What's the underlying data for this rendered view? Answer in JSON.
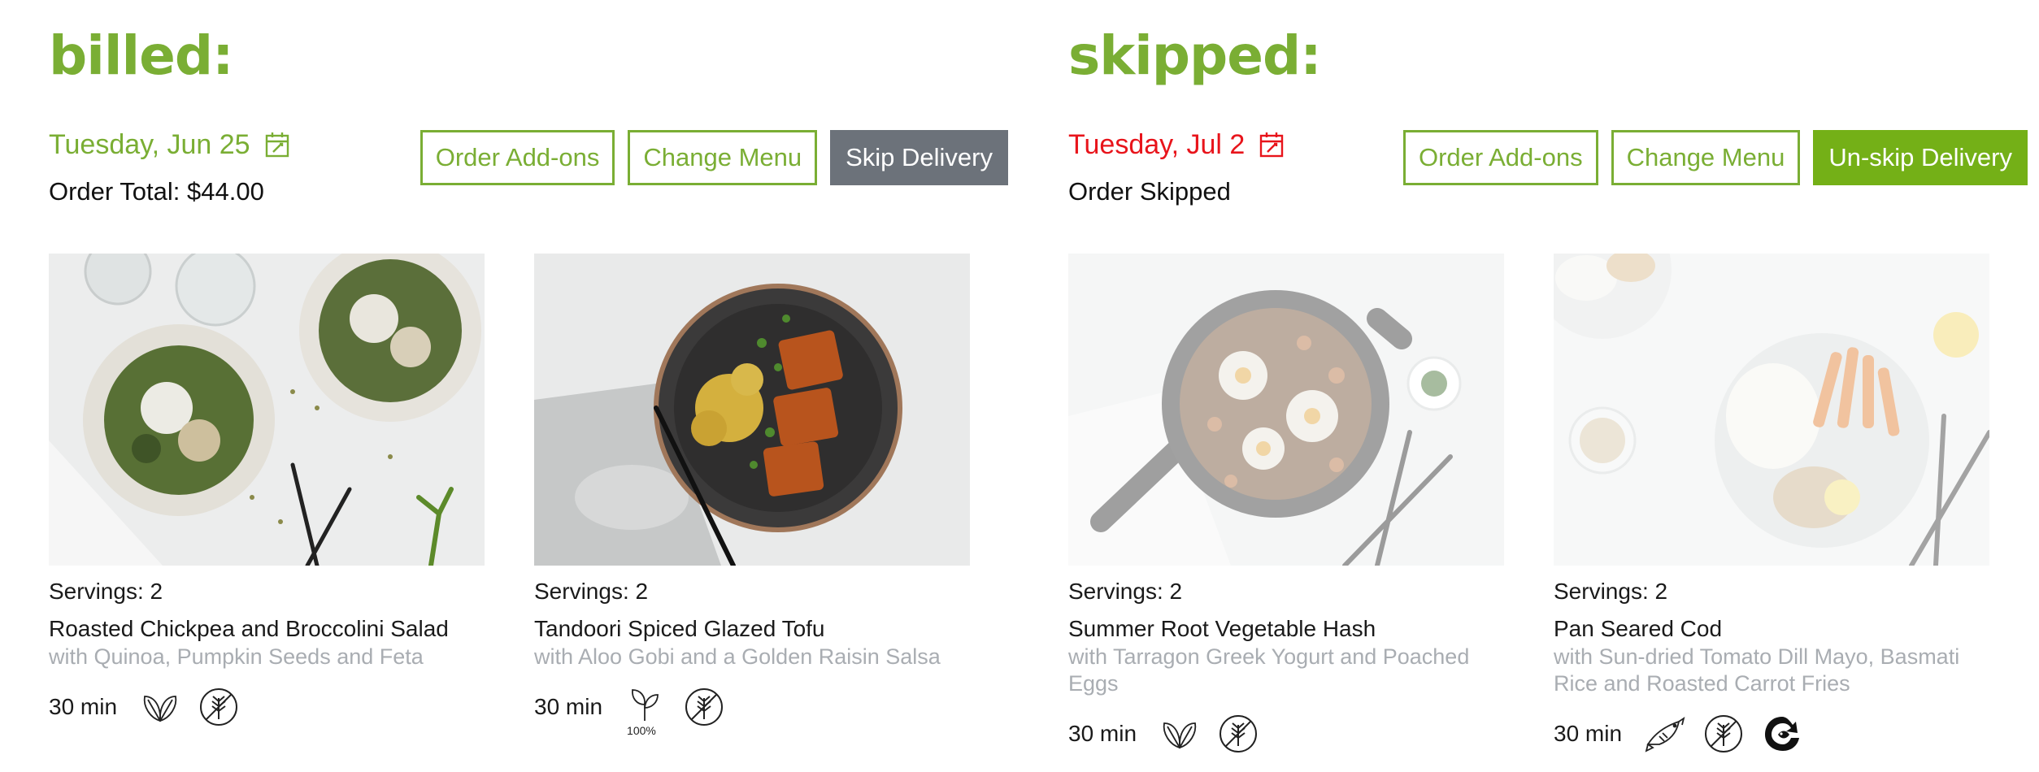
{
  "colors": {
    "accent": "#7aae34",
    "alert": "#e8141b",
    "skip_button": "#6c727a",
    "unskip_button": "#74b017",
    "subtitle": "#a9adb2"
  },
  "billed": {
    "heading": "billed:",
    "date": "Tuesday, Jun 25",
    "order_line": "Order Total: $44.00",
    "buttons": {
      "addons": "Order Add-ons",
      "change": "Change Menu",
      "skip": "Skip Delivery"
    },
    "meals": [
      {
        "servings": "Servings: 2",
        "title": "Roasted Chickpea and Broccolini Salad",
        "subtitle": "with Quinoa, Pumpkin Seeds and Feta",
        "time": "30 min",
        "icons": [
          "leaf-icon",
          "gluten-free-icon"
        ]
      },
      {
        "servings": "Servings: 2",
        "title": "Tandoori Spiced Glazed Tofu",
        "subtitle": "with Aloo Gobi and a Golden Raisin Salsa",
        "time": "30 min",
        "icons": [
          "vegan-100-icon",
          "gluten-free-icon"
        ],
        "badge": "100%"
      }
    ]
  },
  "skipped": {
    "heading": "skipped:",
    "date": "Tuesday, Jul 2",
    "order_line": "Order Skipped",
    "buttons": {
      "addons": "Order Add-ons",
      "change": "Change Menu",
      "unskip": "Un-skip Delivery"
    },
    "meals": [
      {
        "servings": "Servings: 2",
        "title": "Summer Root Vegetable Hash",
        "subtitle": "with Tarragon Greek Yogurt and Poached Eggs",
        "time": "30 min",
        "icons": [
          "leaf-icon",
          "gluten-free-icon"
        ]
      },
      {
        "servings": "Servings: 2",
        "title": "Pan Seared Cod",
        "subtitle": "with Sun-dried Tomato Dill Mayo, Basmati Rice and Roasted Carrot Fries",
        "time": "30 min",
        "icons": [
          "fish-icon",
          "gluten-free-icon",
          "sustainable-seafood-icon"
        ]
      }
    ]
  }
}
